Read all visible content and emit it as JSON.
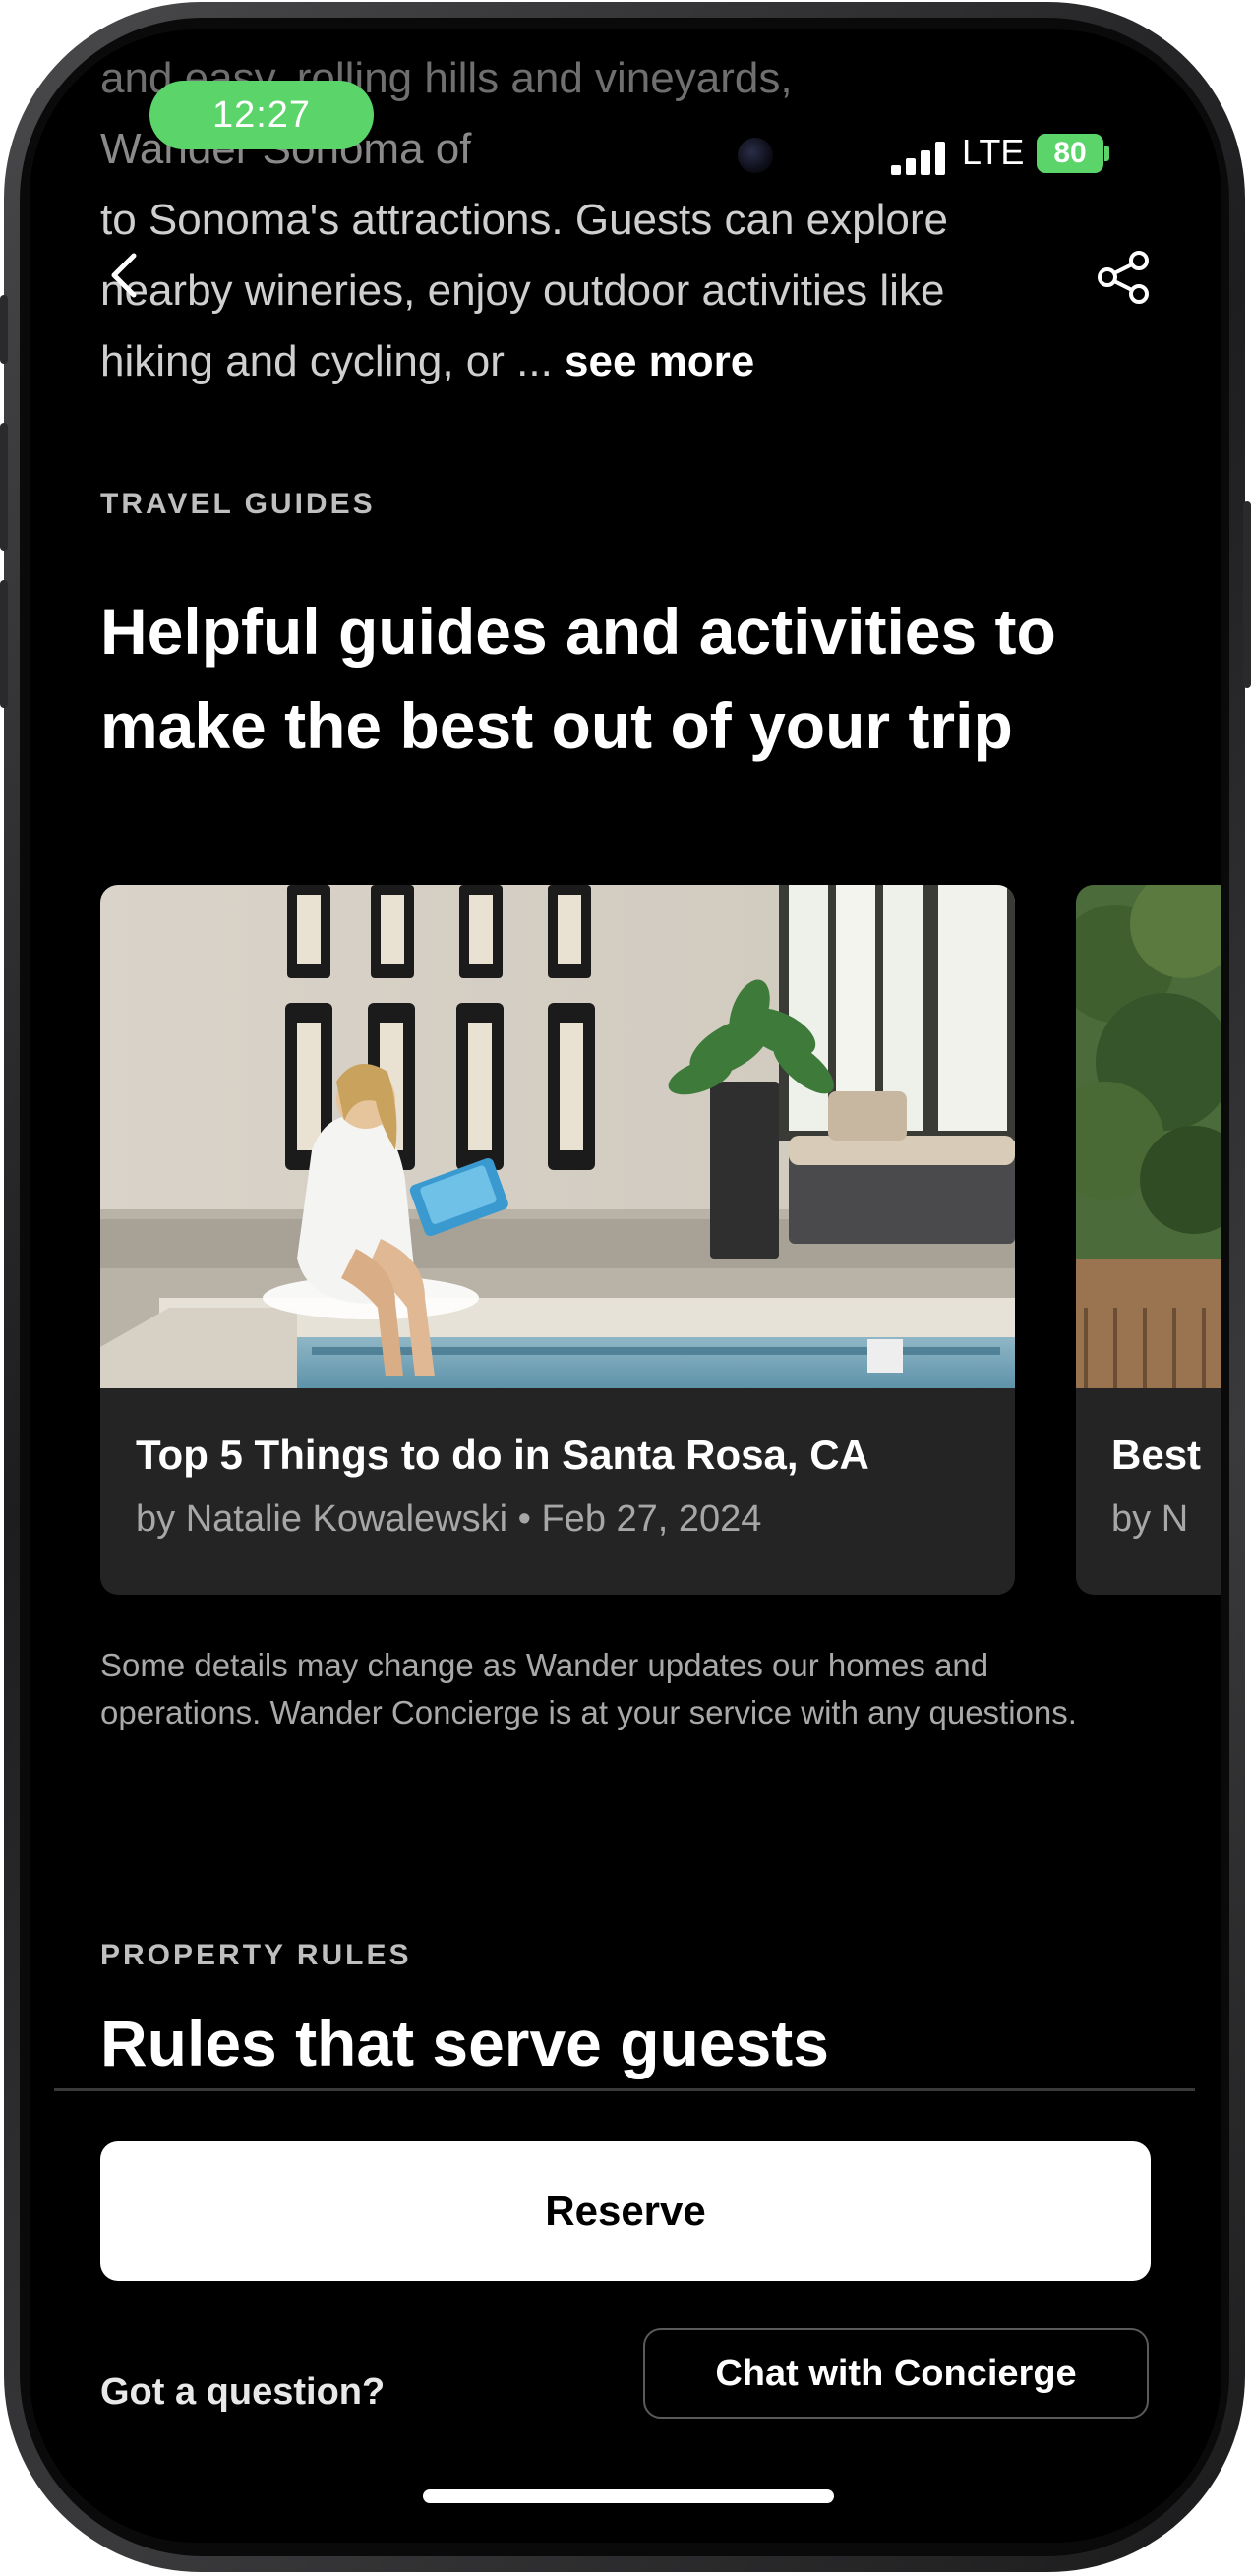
{
  "status_bar": {
    "time": "12:27",
    "network": "LTE",
    "battery": "80"
  },
  "description": {
    "lines": [
      "and easy, rolling hills and vineyards,",
      "Wander Sonoma offers easy access",
      "to Sonoma's attractions. Guests can explore",
      "nearby wineries, enjoy outdoor activities like",
      "hiking and cycling, or ..."
    ],
    "see_more": "see more"
  },
  "nav": {
    "back_icon": "chevron-left-icon",
    "share_icon": "share-icon"
  },
  "travel_guides": {
    "eyebrow": "TRAVEL GUIDES",
    "title": "Helpful guides and activities to make the best out of your trip",
    "cards": [
      {
        "title": "Top 5 Things to do in Santa Rosa, CA",
        "meta": "by Natalie Kowalewski • Feb 27, 2024"
      },
      {
        "title": "Best",
        "meta": "by N"
      }
    ],
    "disclaimer": "Some details may change as Wander updates our homes and operations. Wander Concierge is at your service with any questions."
  },
  "property_rules": {
    "eyebrow": "PROPERTY RULES",
    "title": "Rules that serve guests"
  },
  "footer": {
    "reserve_label": "Reserve",
    "question_label": "Got a question?",
    "chat_label": "Chat with Concierge"
  },
  "colors": {
    "background": "#000000",
    "status_green": "#5bd46a",
    "card": "#242424",
    "reserve_bg": "#ffffff"
  }
}
